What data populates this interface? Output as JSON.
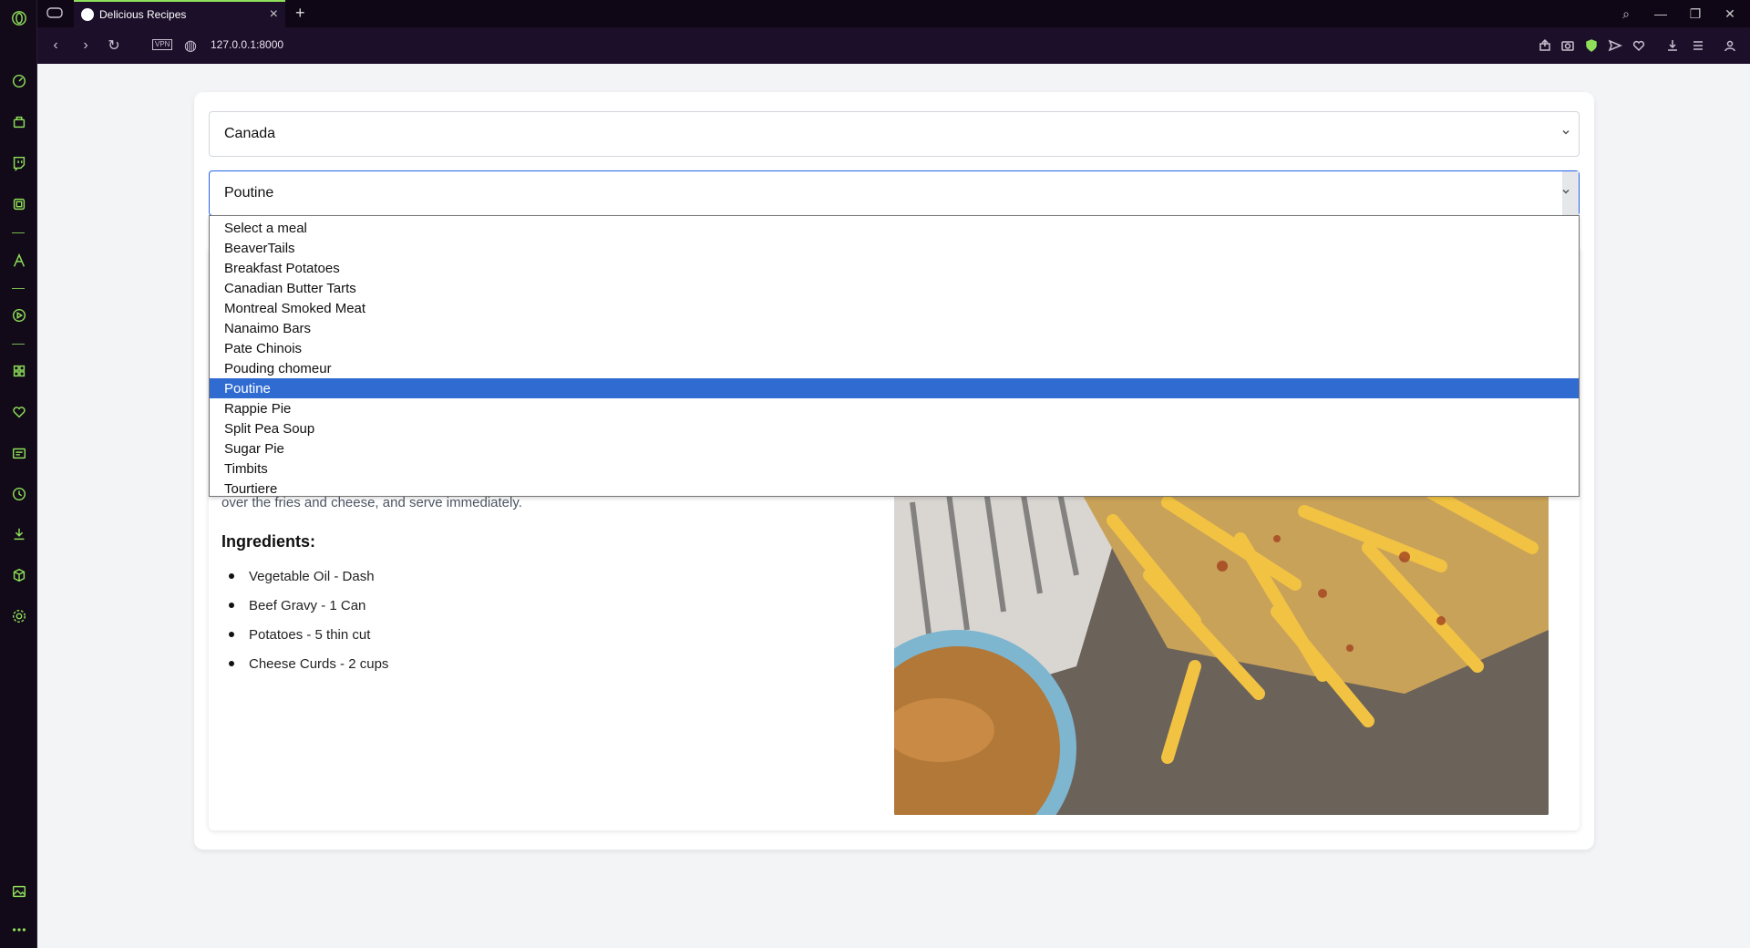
{
  "browser": {
    "tab_title": "Delicious Recipes",
    "url": "127.0.0.1:8000",
    "vpn_label": "VPN",
    "accent": "#8ee05a"
  },
  "filters": {
    "country": "Canada",
    "meal": "Poutine"
  },
  "meal_options": [
    "Select a meal",
    "BeaverTails",
    "Breakfast Potatoes",
    "Canadian Butter Tarts",
    "Montreal Smoked Meat",
    "Nanaimo Bars",
    "Pate Chinois",
    "Pouding chomeur",
    "Poutine",
    "Rappie Pie",
    "Split Pea Soup",
    "Sugar Pie",
    "Timbits",
    "Tourtiere"
  ],
  "selected_index": 8,
  "recipe": {
    "instructions_tail": "over the fries and cheese, and serve immediately.",
    "ingredients_title": "Ingredients:",
    "ingredients": [
      "Vegetable Oil - Dash",
      "Beef Gravy - 1 Can",
      "Potatoes - 5 thin cut",
      "Cheese Curds - 2 cups"
    ]
  },
  "colors": {
    "selected_option": "#2f6bd1",
    "focus_border": "#2563eb"
  }
}
